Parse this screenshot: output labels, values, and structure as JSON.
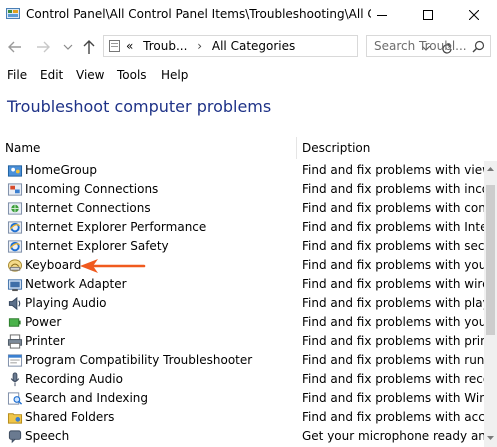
{
  "window": {
    "title": "Control Panel\\All Control Panel Items\\Troubleshooting\\All Ca..."
  },
  "nav": {
    "address_prefix": "«",
    "crumbs": [
      "Troub...",
      "All Categories"
    ],
    "search_placeholder": "Search Troubl..."
  },
  "menu": {
    "items": [
      "File",
      "Edit",
      "View",
      "Tools",
      "Help"
    ]
  },
  "heading": "Troubleshoot computer problems",
  "columns": {
    "name": "Name",
    "description": "Description"
  },
  "rows": [
    {
      "name": "HomeGroup",
      "desc": "Find and fix problems with viewin...",
      "icon": "homegroup-icon"
    },
    {
      "name": "Incoming Connections",
      "desc": "Find and fix problems with incom...",
      "icon": "incoming-connections-icon"
    },
    {
      "name": "Internet Connections",
      "desc": "Find and fix problems with conne...",
      "icon": "internet-connections-icon"
    },
    {
      "name": "Internet Explorer Performance",
      "desc": "Find and fix problems with Intern...",
      "icon": "ie-performance-icon"
    },
    {
      "name": "Internet Explorer Safety",
      "desc": "Find and fix problems with securi...",
      "icon": "ie-safety-icon"
    },
    {
      "name": "Keyboard",
      "desc": "Find and fix problems with your c...",
      "icon": "keyboard-icon"
    },
    {
      "name": "Network Adapter",
      "desc": "Find and fix problems with wirele...",
      "icon": "network-adapter-icon"
    },
    {
      "name": "Playing Audio",
      "desc": "Find and fix problems with playin...",
      "icon": "speaker-icon"
    },
    {
      "name": "Power",
      "desc": "Find and fix problems with your c...",
      "icon": "power-icon"
    },
    {
      "name": "Printer",
      "desc": "Find and fix problems with printi...",
      "icon": "printer-icon"
    },
    {
      "name": "Program Compatibility Troubleshooter",
      "desc": "Find and fix problems with runni...",
      "icon": "program-compat-icon"
    },
    {
      "name": "Recording Audio",
      "desc": "Find and fix problems with record...",
      "icon": "microphone-icon"
    },
    {
      "name": "Search and Indexing",
      "desc": "Find and fix problems with Wind...",
      "icon": "search-indexing-icon"
    },
    {
      "name": "Shared Folders",
      "desc": "Find and fix problems with access...",
      "icon": "shared-folders-icon"
    },
    {
      "name": "Speech",
      "desc": "Get your microphone ready and fi...",
      "icon": "speech-icon"
    }
  ],
  "colors": {
    "heading": "#1e3287",
    "annotation_arrow": "#f05a1e"
  }
}
